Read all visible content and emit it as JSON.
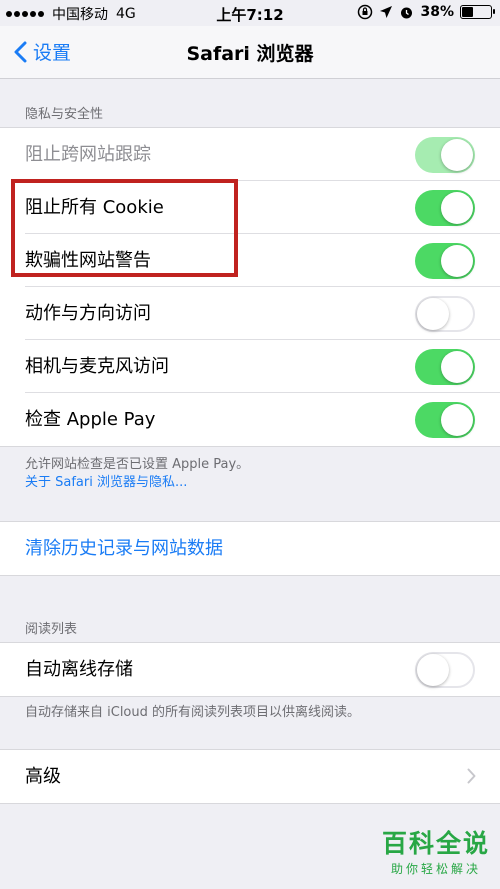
{
  "status_bar": {
    "carrier": "中国移动",
    "network": "4G",
    "time": "上午7:12",
    "battery_percent": "38%",
    "battery_level": 0.38
  },
  "nav": {
    "back_label": "设置",
    "title": "Safari 浏览器"
  },
  "privacy_section": {
    "header": "隐私与安全性",
    "rows": [
      {
        "label": "阻止跨网站跟踪",
        "on": true,
        "dimmed": true
      },
      {
        "label": "阻止所有 Cookie",
        "on": true
      },
      {
        "label": "欺骗性网站警告",
        "on": true
      },
      {
        "label": "动作与方向访问",
        "on": false
      },
      {
        "label": "相机与麦克风访问",
        "on": true
      },
      {
        "label": "检查 Apple Pay",
        "on": true
      }
    ],
    "footer_text": "允许网站检查是否已设置 Apple Pay。",
    "footer_link": "关于 Safari 浏览器与隐私..."
  },
  "clear_history": {
    "label": "清除历史记录与网站数据"
  },
  "reading_list_section": {
    "header": "阅读列表",
    "row_label": "自动离线存储",
    "row_on": false,
    "footer_text": "自动存储来自 iCloud 的所有阅读列表项目以供离线阅读。"
  },
  "advanced": {
    "label": "高级"
  },
  "watermark": {
    "title": "百科全说",
    "subtitle": "助你轻松解决"
  },
  "colors": {
    "accent": "#1a7cf5",
    "toggle_on": "#4cd964",
    "highlight_box": "#c0221f",
    "watermark": "#28a745"
  }
}
